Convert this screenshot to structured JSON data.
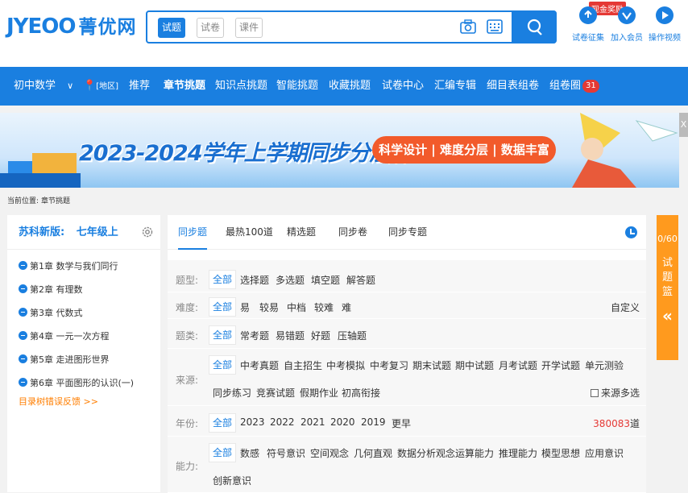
{
  "header": {
    "logo_latin": "JYEOO",
    "logo_cn": "菁优网",
    "search_tabs": [
      "试题",
      "试卷",
      "课件"
    ],
    "reward_badge": "现金奖励",
    "top_links": [
      "试卷征集",
      "加入会员",
      "操作视频"
    ]
  },
  "nav": {
    "grade": "初中数学",
    "region": "[地区]",
    "items": [
      "推荐",
      "章节挑题",
      "知识点挑题",
      "智能挑题",
      "收藏挑题",
      "试卷中心",
      "汇编专辑",
      "细目表组卷",
      "组卷圈"
    ],
    "badge": "31"
  },
  "banner": {
    "title": "2023-2024学年上学期同步分层作业",
    "pill": "科学设计 | 难度分层 | 数据丰富",
    "close": "X"
  },
  "breadcrumb": {
    "label": "当前位置:",
    "current": "章节挑题"
  },
  "sidebar": {
    "edition": "苏科新版:",
    "grade": "七年级上",
    "chapters": [
      "第1章  数学与我们同行",
      "第2章 有理数",
      "第3章 代数式",
      "第4章 一元一次方程",
      "第5章 走进图形世界",
      "第6章 平面图形的认识(一)"
    ],
    "feedback": "目录树错误反馈 >>"
  },
  "tabs": [
    "同步题",
    "最热100道",
    "精选题",
    "同步卷",
    "同步专题"
  ],
  "filters": {
    "type": {
      "label": "题型:",
      "options": [
        "全部",
        "选择题",
        "多选题",
        "填空题",
        "解答题"
      ]
    },
    "difficulty": {
      "label": "难度:",
      "options": [
        "全部",
        "易",
        "较易",
        "中档",
        "较难",
        "难"
      ],
      "right": "自定义"
    },
    "category": {
      "label": "题类:",
      "options": [
        "全部",
        "常考题",
        "易错题",
        "好题",
        "压轴题"
      ]
    },
    "source": {
      "label": "来源:",
      "options": [
        "全部",
        "中考真题",
        "自主招生",
        "中考模拟",
        "中考复习",
        "期末试题",
        "期中试题",
        "月考试题",
        "开学试题",
        "单元测验"
      ],
      "options2": [
        "同步练习",
        "竞赛试题",
        "假期作业",
        "初高衔接"
      ],
      "multi": "来源多选"
    },
    "year": {
      "label": "年份:",
      "options": [
        "全部",
        "2023",
        "2022",
        "2021",
        "2020",
        "2019",
        "更早"
      ],
      "count": "380083",
      "count_unit": "道"
    },
    "ability": {
      "label": "能力:",
      "options": [
        "全部",
        "数感",
        "符号意识",
        "空间观念",
        "几何直观",
        "数据分析观念",
        "运算能力",
        "推理能力",
        "模型思想",
        "应用意识"
      ],
      "options2": [
        "创新意识"
      ]
    }
  },
  "basket": {
    "count": "0/60",
    "label": "试题篮",
    "arrow": "«"
  },
  "colors": {
    "primary": "#1a7fe0",
    "accent": "#ff9a1e",
    "red": "#e53935"
  }
}
